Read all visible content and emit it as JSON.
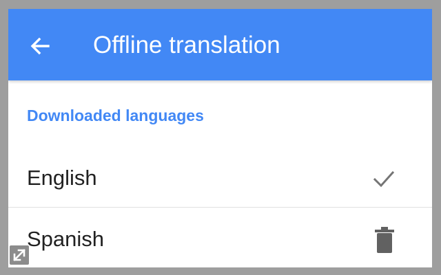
{
  "app_bar": {
    "title": "Offline translation",
    "back_icon": "arrow-left-icon",
    "background": "#4288f5"
  },
  "section": {
    "header": "Downloaded languages",
    "color": "#4288f5"
  },
  "languages": [
    {
      "name": "English",
      "action_icon": "checkmark-icon"
    },
    {
      "name": "Spanish",
      "action_icon": "trash-icon"
    }
  ],
  "overlay": {
    "expand_icon": "expand-icon"
  }
}
